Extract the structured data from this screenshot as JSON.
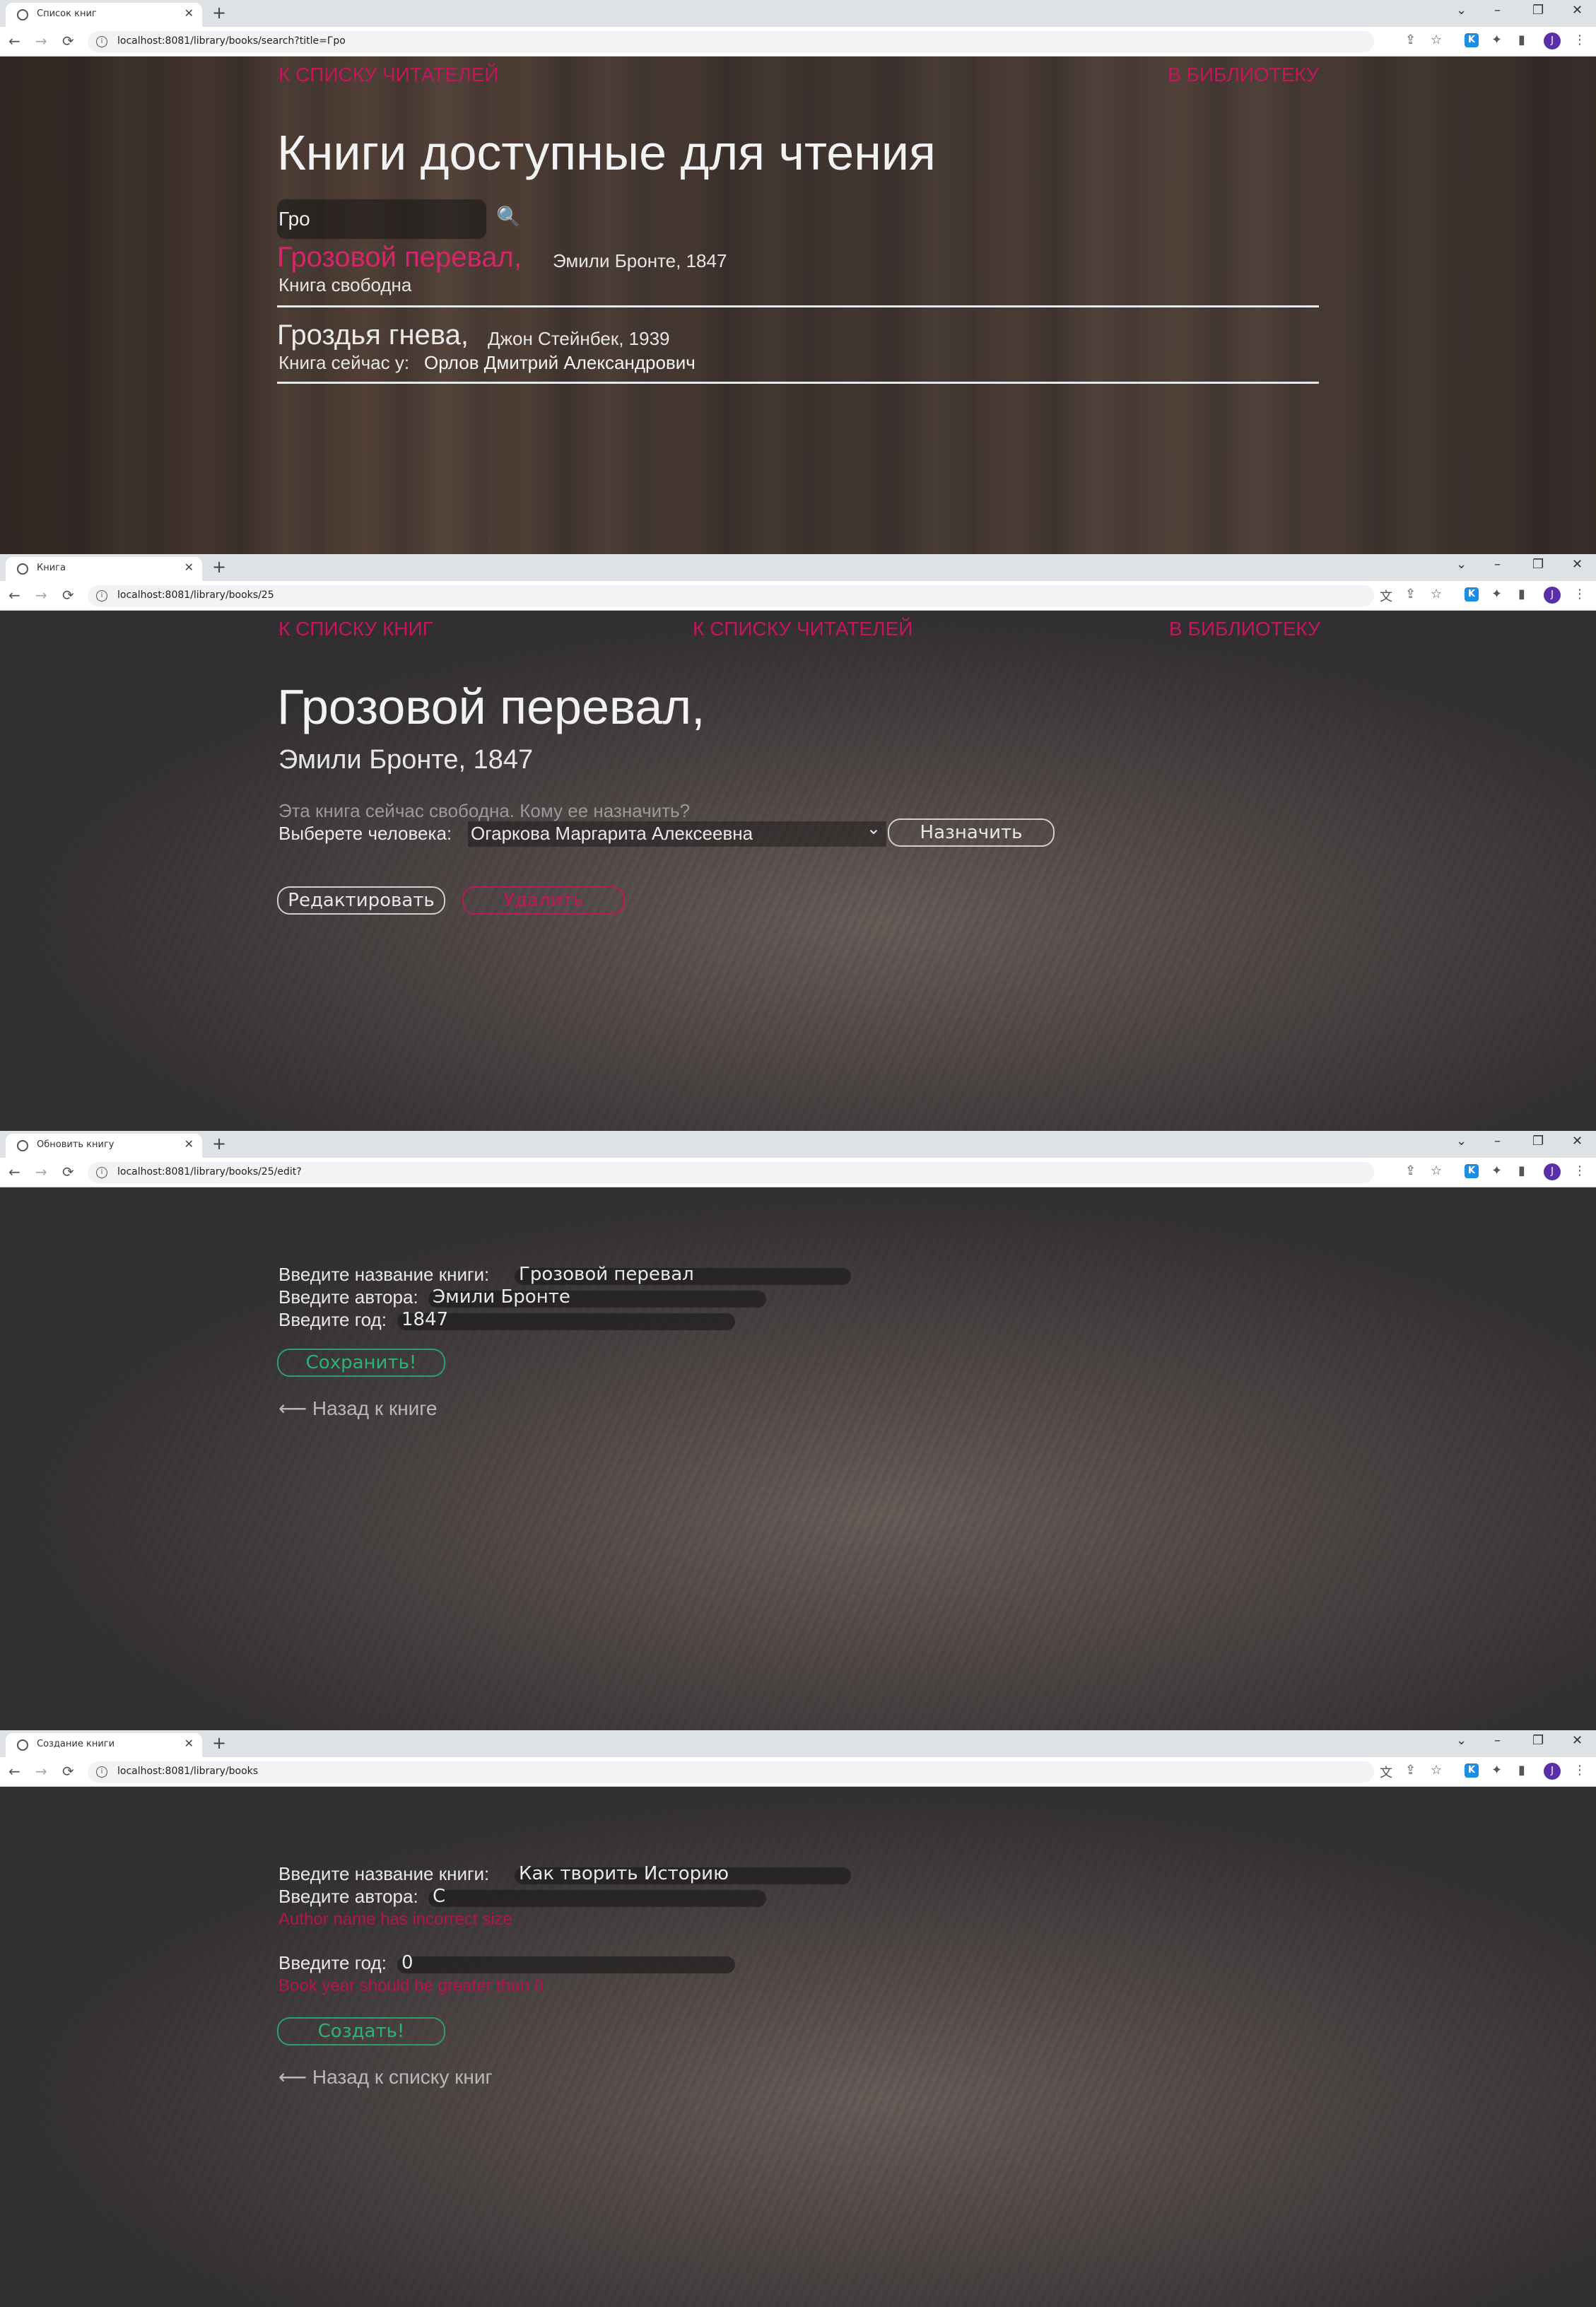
{
  "window_controls": {
    "list": "⌄",
    "minimize": "–",
    "restore": "❐",
    "close": "✕"
  },
  "nav_icons": {
    "back": "←",
    "forward": "→",
    "reload": "⟳"
  },
  "toolbar_icons": {
    "translate": "文",
    "share": "⇪",
    "star": "☆",
    "kaspersky": "K",
    "extensions": "✦",
    "sidepanel": "▮",
    "profile": "J",
    "menu": "⋮"
  },
  "screen1": {
    "tab_title": "Список книг",
    "url": "localhost:8081/library/books/search?title=Гро",
    "nav_readers": "К СПИСКУ ЧИТАТЕЛЕЙ",
    "nav_library": "В БИБЛИОТЕКУ",
    "heading": "Книги доступные для чтения",
    "search_value": "Гро",
    "search_icon": "🔍",
    "results": [
      {
        "title": "Грозовой перевал,",
        "meta": "Эмили Бронте, 1847",
        "status": "Книга свободна",
        "owner": ""
      },
      {
        "title": "Гроздья гнева,",
        "meta": "Джон Стейнбек, 1939",
        "status": "Книга сейчас у:",
        "owner": "Орлов Дмитрий Александрович"
      }
    ]
  },
  "screen2": {
    "tab_title": "Книга",
    "url": "localhost:8081/library/books/25",
    "nav_books": "К СПИСКУ КНИГ",
    "nav_readers": "К СПИСКУ ЧИТАТЕЛЕЙ",
    "nav_library": "В БИБЛИОТЕКУ",
    "title": "Грозовой перевал,",
    "subtitle": "Эмили Бронте, 1847",
    "free_hint": "Эта книга сейчас свободна. Кому ее назначить?",
    "choose_label": "Выберете человека:",
    "selected_person": "Огаркова Маргарита Алексеевна",
    "select_arrow": "⌄",
    "assign_button": "Назначить",
    "edit_button": "Редактировать",
    "delete_button": "Удалить"
  },
  "screen3": {
    "tab_title": "Обновить книгу",
    "url": "localhost:8081/library/books/25/edit?",
    "title_label": "Введите название книги:",
    "title_value": "Грозовой перевал",
    "author_label": "Введите автора:",
    "author_value": "Эмили Бронте",
    "year_label": "Введите год:",
    "year_value": "1847",
    "save_button": "Сохранить!",
    "back_link": "⟵ Назад к книге"
  },
  "screen4": {
    "tab_title": "Создание книги",
    "url": "localhost:8081/library/books",
    "title_label": "Введите название книги:",
    "title_value": "Как творить Историю",
    "author_label": "Введите автора:",
    "author_value": "C",
    "author_error": "Author name has incorrect size",
    "year_label": "Введите год:",
    "year_value": "0",
    "year_error": "Book year should be greater than 0",
    "create_button": "Создать!",
    "back_link": "⟵ Назад к списку книг"
  }
}
